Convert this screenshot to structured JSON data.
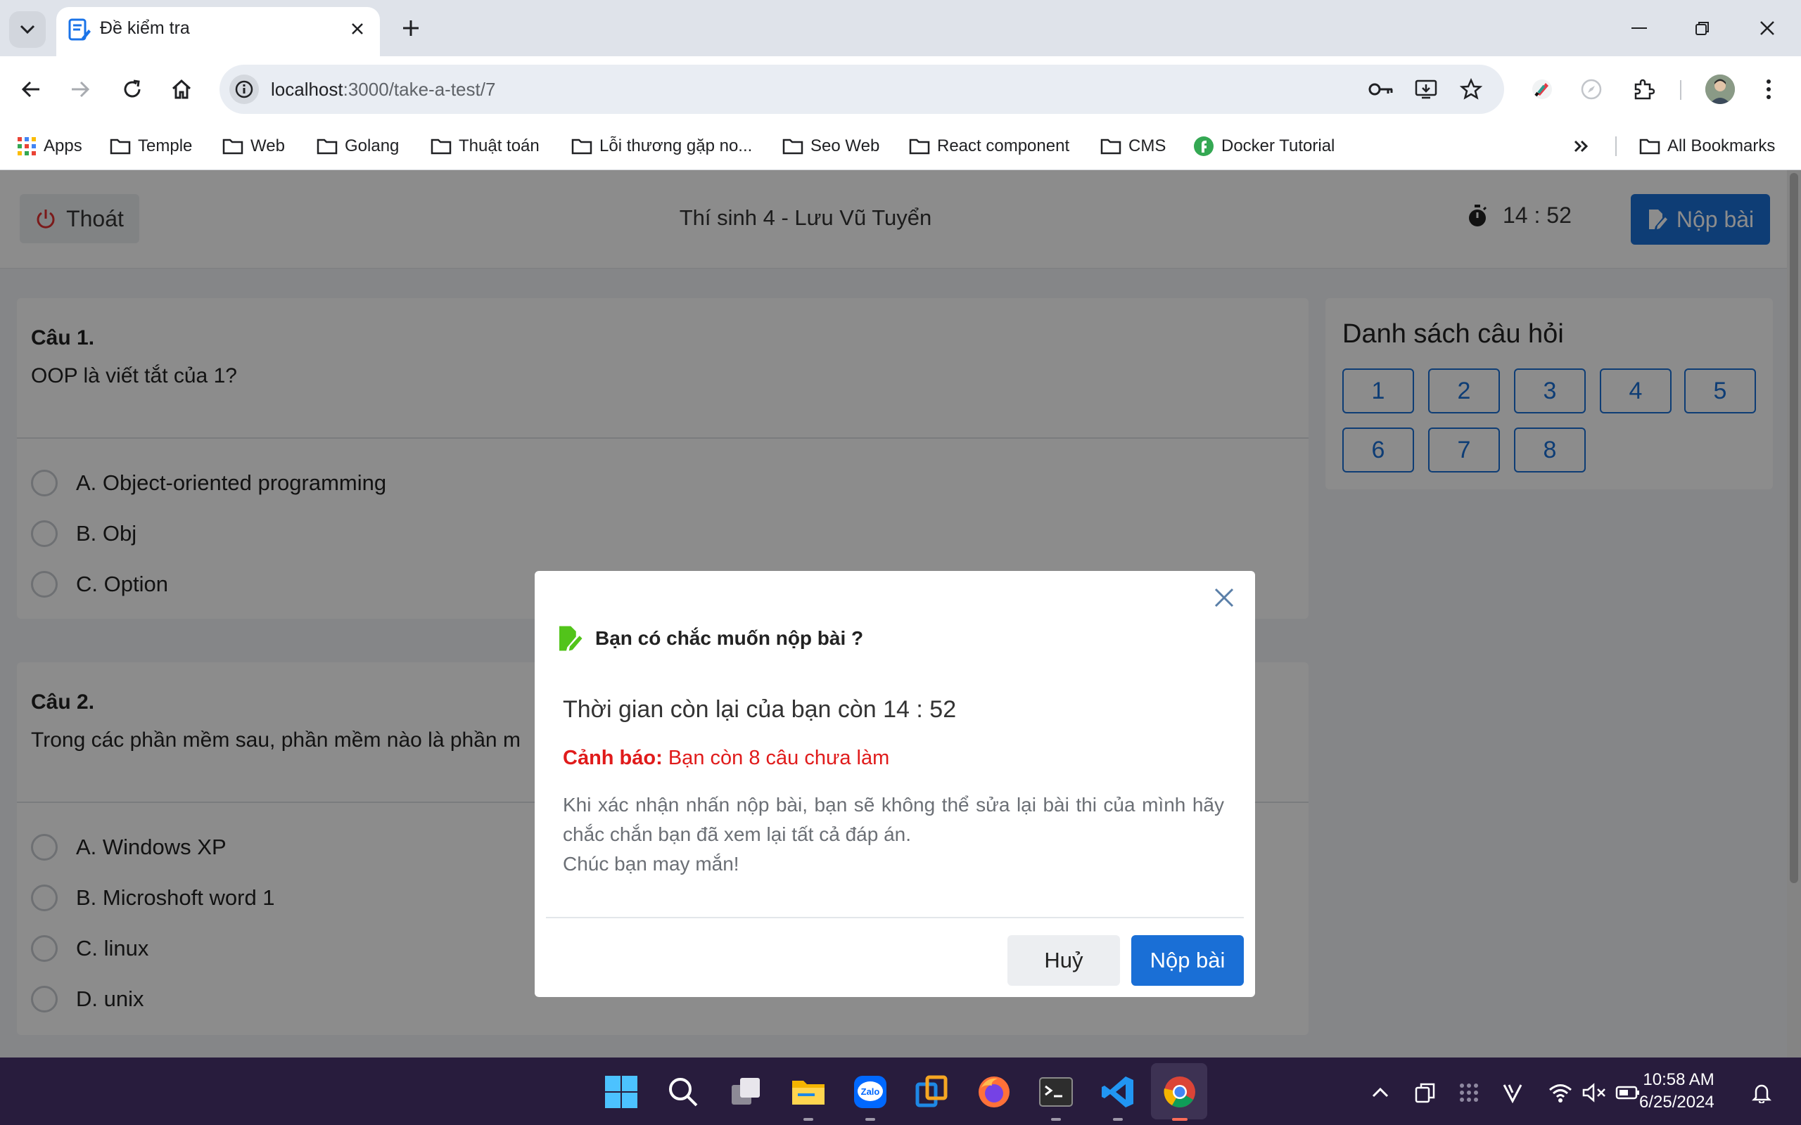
{
  "browser": {
    "tab_title": "Đề kiểm tra",
    "url_host": "localhost",
    "url_path": ":3000/take-a-test/7",
    "bookmarks": [
      {
        "label": "Apps",
        "icon": "apps-grid-icon"
      },
      {
        "label": "Temple",
        "icon": "folder-icon"
      },
      {
        "label": "Web",
        "icon": "folder-icon"
      },
      {
        "label": "Golang",
        "icon": "folder-icon"
      },
      {
        "label": "Thuật toán",
        "icon": "folder-icon"
      },
      {
        "label": "Lỗi thương gặp no...",
        "icon": "folder-icon"
      },
      {
        "label": "Seo Web",
        "icon": "folder-icon"
      },
      {
        "label": "React component",
        "icon": "folder-icon"
      },
      {
        "label": "CMS",
        "icon": "folder-icon"
      },
      {
        "label": "Docker Tutorial",
        "icon": "docker-tutorial-icon"
      }
    ],
    "all_bookmarks": "All Bookmarks"
  },
  "header": {
    "exit_label": "Thoát",
    "candidate": "Thí sinh 4 - Lưu Vũ Tuyển",
    "timer": "14 : 52",
    "submit_label": "Nộp bài"
  },
  "questions": [
    {
      "number": "Câu 1.",
      "text": "OOP là viết tắt của 1?",
      "options": [
        "A. Object-oriented programming",
        "B. Obj",
        "C. Option"
      ]
    },
    {
      "number": "Câu 2.",
      "text": "Trong các phần mềm sau, phần mềm nào là phần m",
      "options": [
        "A. Windows XP",
        "B. Microshoft word 1",
        "C. linux",
        "D. unix"
      ]
    }
  ],
  "question_list": {
    "title": "Danh sách câu hỏi",
    "items": [
      "1",
      "2",
      "3",
      "4",
      "5",
      "6",
      "7",
      "8"
    ]
  },
  "modal": {
    "title": "Bạn có chắc muốn nộp bài ?",
    "time_left": "Thời gian còn lại của bạn còn 14 : 52",
    "warning_label": "Cảnh báo:",
    "warning_text": "Bạn còn 8 câu chưa làm",
    "note_line1": "Khi xác nhận nhấn nộp bài, bạn sẽ không thể sửa lại bài thi của mình hãy chắc chắn bạn đã xem lại tất cả đáp án.",
    "note_line2": "Chúc bạn may mắn!",
    "cancel_label": "Huỷ",
    "submit_label": "Nộp bài"
  },
  "taskbar": {
    "time": "10:58 AM",
    "date": "6/25/2024"
  },
  "colors": {
    "primary": "#1a6fd6",
    "danger": "#e01b1b",
    "modal_icon": "#52c41a",
    "exit_icon": "#e03131"
  }
}
